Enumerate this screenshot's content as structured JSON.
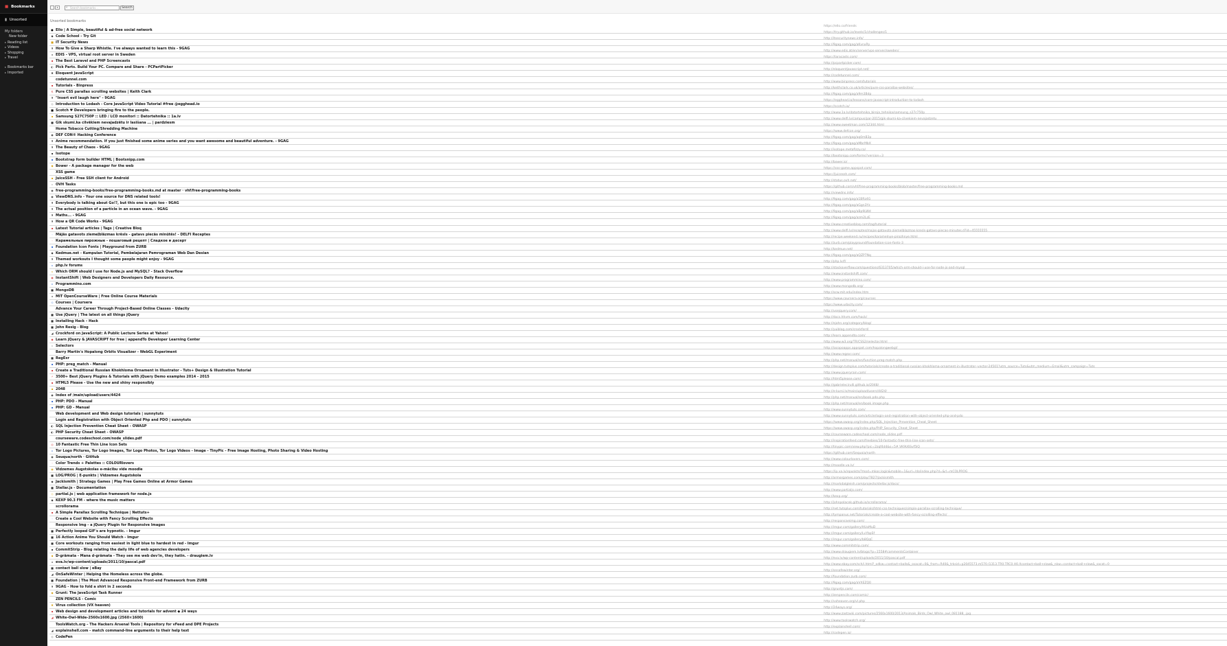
{
  "colors": {
    "sidebar_bg": "#1b1b1b",
    "accent": "#e04040",
    "url_text": "#9a9a9a"
  },
  "sidebar": {
    "title": "Bookmarks",
    "title_icon": "bookmark-icon",
    "unsorted": "Unsorted",
    "my_folders": "My folders",
    "folders": [
      {
        "label": "New folder",
        "indent": true
      },
      {
        "label": "Reading list"
      },
      {
        "label": "Videos"
      },
      {
        "label": "Shopping"
      },
      {
        "label": "Travel"
      }
    ],
    "other": [
      {
        "label": "Bookmarks bar"
      },
      {
        "label": "Imported"
      }
    ]
  },
  "toolbar": {
    "search_placeholder": "Search bookmarks...",
    "search_button": "Search"
  },
  "breadcrumb": "Unsorted bookmarks",
  "bookmarks": [
    {
      "title": "Ello | A Simple, beautiful & ad-free social network",
      "url": "https://ello.co/friends",
      "icon": "●",
      "color": "#000"
    },
    {
      "title": "Code School - Try Git",
      "url": "https://try.github.io/levels/1/challenges/1",
      "icon": "◆",
      "color": "#333"
    },
    {
      "title": "IT Security News",
      "url": "http://itsecuritynews.info/",
      "icon": "■",
      "color": "#d4a017"
    },
    {
      "title": "How To Give a Sharp Whistle. I've always wanted to learn this - 9GAG",
      "url": "http://9gag.com/gag/aKvnxPp",
      "icon": "9",
      "color": "#000"
    },
    {
      "title": "EDIS - VPS, virtual root server in Sweden",
      "url": "http://www.edis.at/en/server/vps-server/sweden/",
      "icon": "▪",
      "color": "#999"
    },
    {
      "title": "The Best Laravel and PHP Screencasts",
      "url": "https://laracasts.com/",
      "icon": "▪",
      "color": "#d04040"
    },
    {
      "title": "Pick Parts. Build Your PC. Compare and Share - PCPartPicker",
      "url": "http://pcpartpicker.com/",
      "icon": "◐",
      "color": "#555"
    },
    {
      "title": "Eloquent JavaScript",
      "url": "http://eloquentjavascript.net/",
      "icon": "✖",
      "color": "#333"
    },
    {
      "title": "codetunnel.com",
      "url": "http://codetunnel.com/",
      "icon": "",
      "color": "#999"
    },
    {
      "title": "Tutorials - Binpress",
      "url": "http://www.binpress.com/tutorials",
      "icon": "▪",
      "color": "#d04040"
    },
    {
      "title": "Pure CSS parallax scrolling websites | Keith Clark",
      "url": "http://keithclark.co.uk/articles/pure-css-parallax-websites/",
      "icon": "K",
      "color": "#d04040"
    },
    {
      "title": "\"Insert evil laugh here\" - 9GAG",
      "url": "http://9gag.com/gag/a9m3Bdp",
      "icon": "9",
      "color": "#000"
    },
    {
      "title": "Introduction to Lodash - Core JavaScript Video Tutorial #free @egghead.io",
      "url": "https://egghead.io/lessons/core-javascript-introduction-to-lodash",
      "icon": "◇",
      "color": "#555"
    },
    {
      "title": "Scotch ♥ Developers bringing fire to the people.",
      "url": "https://scotch.io/",
      "icon": "■",
      "color": "#000"
    },
    {
      "title": "Samsung S27C750P :: LED / LCD monitori :: Datortehnika :: 1a.lv",
      "url": "http://www.1a.lv/datortehnika_biroja_tehnika/samsung_s27c750p",
      "icon": "▪",
      "color": "#d4a017"
    },
    {
      "title": "Gik skumi.ka cilvēkiem nevajadzētu ir lasīšana ... | pardziesm",
      "url": "http://www.delfi.lv/campus/par-2015/gik-skumi-ka-cilvekiem-nevajadzetu",
      "icon": "■",
      "color": "#333"
    },
    {
      "title": "Home Tobacco Cutting/Shredding Machine",
      "url": "http://www.sweetman.com/12344.html",
      "icon": "",
      "color": "#999"
    },
    {
      "title": "DEF CON® Hacking Conference",
      "url": "https://www.defcon.org/",
      "icon": "◉",
      "color": "#333"
    },
    {
      "title": "Anime recommendation. If you just finished some anime series and you want awesome and beautiful adventure. - 9GAG",
      "url": "http://9gag.com/gag/aq0mB3p",
      "icon": "9",
      "color": "#000"
    },
    {
      "title": "The Beauty of Chaos - 9GAG",
      "url": "http://9gag.com/gag/aMbrMbX",
      "icon": "9",
      "color": "#000"
    },
    {
      "title": "Isotope",
      "url": "http://isotope.metafizzy.co/",
      "icon": "▪",
      "color": "#333"
    },
    {
      "title": "Bootstrap form builder HTML | Bootsnipp.com",
      "url": "http://bootsnipp.com/forms?version=3",
      "icon": "▪",
      "color": "#3a6fd0"
    },
    {
      "title": "Bower - A package manager for the web",
      "url": "http://bower.io/",
      "icon": "◆",
      "color": "#d4a017"
    },
    {
      "title": "XSS game",
      "url": "https://xss-game.appspot.com/",
      "icon": "",
      "color": "#999"
    },
    {
      "title": "JuiceSSH - Free SSH client for Android",
      "url": "https://juicessh.com/",
      "icon": "▪",
      "color": "#d4a017"
    },
    {
      "title": "OVH Tasks",
      "url": "http://status.ovh.net/",
      "icon": "▫",
      "color": "#999"
    },
    {
      "title": "free-programming-books/free-programming-books.md at master · vhf/free-programming-books",
      "url": "https://github.com/vhf/free-programming-books/blob/master/free-programming-books.md",
      "icon": "◉",
      "color": "#333"
    },
    {
      "title": "ViewDNS.info - Your one source for DNS related tools!",
      "url": "http://viewdns.info/",
      "icon": "◉",
      "color": "#333"
    },
    {
      "title": "Everybody is talking about Go!?, but this one is epic too - 9GAG",
      "url": "http://9gag.com/gag/a1BRz4G",
      "icon": "9",
      "color": "#000"
    },
    {
      "title": "The actual position of a particle in an ocean wave. - 9GAG",
      "url": "http://9gag.com/gag/aGgn3Yz",
      "icon": "9",
      "color": "#000"
    },
    {
      "title": "Maths... - 9GAG",
      "url": "http://9gag.com/gag/aBp9LWd",
      "icon": "9",
      "color": "#000"
    },
    {
      "title": "How a QR Code Works - 9GAG",
      "url": "http://9gag.com/gag/azm2LzE",
      "icon": "9",
      "color": "#000"
    },
    {
      "title": "Latest Tutorial articles | Tags | Creative Bloq",
      "url": "http://www.creativebloq.com/tag/tutorial",
      "icon": "▪",
      "color": "#d04040"
    },
    {
      "title": "Mājās gatavots ziemeļblāzmas krēsls - gatavs piecās minūtēs! - DELFI Receptes",
      "url": "http://www.delfi.lv/receptes/majas-gatavots-ziemelblazmas-kresls-gatavs-piecas-minutes.d?id=45555555",
      "icon": "◦",
      "color": "#3a6fd0"
    },
    {
      "title": "Карамельные пирожные - пошаговый рецепт | Сладкое и десерт",
      "url": "http://recipe.weekend.ru/recipes/karamelnye-pirozhnye.html",
      "icon": "◦",
      "color": "#d04040"
    },
    {
      "title": "Foundation Icon Fonts | Playground from ZURB",
      "url": "http://zurb.com/playground/foundation-icon-fonts-3",
      "icon": "▪",
      "color": "#3a6fd0"
    },
    {
      "title": "Kedmue.net - Kumpulan Tutorial, Pembelajaran Pemrograman Web Dan Desian",
      "url": "http://kedmue.net/",
      "icon": "◆",
      "color": "#333"
    },
    {
      "title": "Themed workouts I thought some people might enjoy - 9GAG",
      "url": "http://9gag.com/gag/aQZP7Nq",
      "icon": "9",
      "color": "#000"
    },
    {
      "title": "php.lv forums",
      "url": "http://php.lv/f/",
      "icon": "▫",
      "color": "#3a6fd0"
    },
    {
      "title": "Which ORM should I use for Node.js and MySQL? - Stack Overflow",
      "url": "http://stackoverflow.com/questions/6313705/which-orm-should-i-use-for-node-js-and-mysql",
      "icon": "▫",
      "color": "#d4a017"
    },
    {
      "title": "InstantShift | Web Designers and Developers Daily Resource.",
      "url": "http://www.instantshift.com/",
      "icon": "◉",
      "color": "#d04040"
    },
    {
      "title": "Programmino.com",
      "url": "http://www.programmino.com/",
      "icon": "▫",
      "color": "#3a6fd0"
    },
    {
      "title": "MongoDB",
      "url": "http://www.mongodb.org/",
      "icon": "■",
      "color": "#333"
    },
    {
      "title": "MIT OpenCourseWare | Free Online Course Materials",
      "url": "http://ocw.mit.edu/index.htm",
      "icon": "▪",
      "color": "#999"
    },
    {
      "title": "Courses | Coursera",
      "url": "https://www.coursera.org/courses",
      "icon": "◇",
      "color": "#3a6fd0"
    },
    {
      "title": "Advance Your Career Through Project-Based Online Classes - Udacity",
      "url": "https://www.udacity.com/",
      "icon": "",
      "color": "#999"
    },
    {
      "title": "Use jQuery | The latest on all things jQuery",
      "url": "http://usejquery.com/",
      "icon": "■",
      "color": "#333"
    },
    {
      "title": "Installing Hack – Hack",
      "url": "http://docs.hhvm.com/hack/",
      "icon": "■",
      "color": "#333"
    },
    {
      "title": "John Resig - Blog",
      "url": "http://ejohn.org/category/blog/",
      "icon": "■",
      "color": "#333"
    },
    {
      "title": "Crockford on JavaScript: A Public Lecture Series at Yahoo!",
      "url": "http://yuiblog.com/crockford/",
      "icon": "◢",
      "color": "#333"
    },
    {
      "title": "Learn jQuery & JAVASCRIPT for free | appendTo Developer Learning Center",
      "url": "http://learn.appendto.com/",
      "icon": "◆",
      "color": "#d04040"
    },
    {
      "title": "Selectors",
      "url": "http://www.w3.org/TR/CSS2/selector.html",
      "icon": "▫",
      "color": "#999"
    },
    {
      "title": "Barry Martin's Hopalong Orbits Visualizer - WebGL Experiment",
      "url": "http://iacopoapps.appspot.com/hopalongwebgl/",
      "icon": "",
      "color": "#999"
    },
    {
      "title": "RegExr",
      "url": "http://www.regexr.com/",
      "icon": "■",
      "color": "#333"
    },
    {
      "title": "PHP: preg_match - Manual",
      "url": "http://php.net/manual/en/function.preg-match.php",
      "icon": "▪",
      "color": "#3a6fd0"
    },
    {
      "title": "Create a Traditional Russian Khokhloma Ornament in Illustrator - Tuts+ Design & Illustration Tutorial",
      "url": "http://design.tutsplus.com/tutorials/create-a-traditional-russian-khokhloma-ornament-in-illustrator--vector-24501?utm_source=Tuts&utm_medium=Email&utm_campaign=Tuts",
      "icon": "▪",
      "color": "#d04040"
    },
    {
      "title": "3500+ Best jQuery Plugins & Tutorials with jQuery Demo examples 2014 - 2015",
      "url": "http://www.jqueryrain.com/",
      "icon": "⚡",
      "color": "#d04040"
    },
    {
      "title": "HTML5 Please - Use the new and shiny responsibly",
      "url": "http://html5please.com/",
      "icon": "▪",
      "color": "#d04040"
    },
    {
      "title": "2048",
      "url": "http://gabrielecirulli.github.io/2048/",
      "icon": "▪",
      "color": "#d4a017"
    },
    {
      "title": "Index of /main/upload/users/4424",
      "url": "http://e-kursi.lv/main/upload/users/4424/",
      "icon": "◉",
      "color": "#333"
    },
    {
      "title": "PHP: PDO - Manual",
      "url": "http://php.net/manual/en/book.pdo.php",
      "icon": "▪",
      "color": "#3a6fd0"
    },
    {
      "title": "PHP: GD - Manual",
      "url": "http://php.net/manual/en/book.image.php",
      "icon": "▪",
      "color": "#3a6fd0"
    },
    {
      "title": "Web development and Web design tutorials | sunnytuts",
      "url": "http://www.sunnytuts.com/",
      "icon": "",
      "color": "#999"
    },
    {
      "title": "Login and Registration with Object Oriented Php and PDO | sunnytuts",
      "url": "http://www.sunnytuts.com/article/login-and-registration-with-object-oriented-php-and-pdo",
      "icon": "",
      "color": "#999"
    },
    {
      "title": "SQL Injection Prevention Cheat Sheet - OWASP",
      "url": "https://www.owasp.org/index.php/SQL_Injection_Prevention_Cheat_Sheet",
      "icon": "◐",
      "color": "#333"
    },
    {
      "title": "PHP Security Cheat Sheet - OWASP",
      "url": "https://www.owasp.org/index.php/PHP_Security_Cheat_Sheet",
      "icon": "◐",
      "color": "#333"
    },
    {
      "title": "courseware.codeschool.com/node_slides.pdf",
      "url": "http://courseware.codeschool.com/node_slides.pdf",
      "icon": "",
      "color": "#999"
    },
    {
      "title": "10 Fantastic Free Thin Line Icon Sets",
      "url": "http://inspirationfeed.com/freebies/10-fantastic-free-thin-line-icon-sets/",
      "icon": "◎",
      "color": "#d04040"
    },
    {
      "title": "Tor Logo Pictures, Tor Logo Images, Tor Logo Photos, Tor Logo Videos - Image - TinyPic - Free Image Hosting, Photo Sharing & Video Hosting",
      "url": "http://tinypic.com/view.php?pic=2zqf4d4&s=5#.VK9U6Svf5IQ",
      "icon": "▫",
      "color": "#3a6fd0"
    },
    {
      "title": "Seuqua/north · GitHub",
      "url": "https://github.com/Sequoia/north",
      "icon": "◉",
      "color": "#333"
    },
    {
      "title": "Color Trends + Palettes :: COLOURlovers",
      "url": "http://www.colourlovers.com/",
      "icon": "◦",
      "color": "#d04040"
    },
    {
      "title": "Vidzemes Augstskolas e-mācību vide moodle",
      "url": "http://moodle.va.lv/",
      "icon": "◉",
      "color": "#d4a017"
    },
    {
      "title": "LOG/PROG | E-punkts | Vidzemes Augstskola",
      "url": "https://ip.va.lv/epunkts/?mod=mkos.login&mobile=1&url=/do/index.php?d=&rl=mCOLPROG",
      "icon": "■",
      "color": "#333"
    },
    {
      "title": "Jackismith | Strategy Games | Play Free Games Online at Armor Games",
      "url": "http://armorgames.com/play/7827/jackismith",
      "icon": "◆",
      "color": "#333"
    },
    {
      "title": "Stellar.js - Documentation",
      "url": "http://markdalgleish.com/projects/stellar.js/docs/",
      "icon": "■",
      "color": "#333"
    },
    {
      "title": "partial.js | web application framework for node.js",
      "url": "http://www.partialjs.com/",
      "icon": "◇",
      "color": "#d4a017"
    },
    {
      "title": "KEXP 90.3 FM - where the music matters",
      "url": "http://kexp.org/",
      "icon": "◆",
      "color": "#333"
    },
    {
      "title": "scrollorama",
      "url": "http://johnpolacek.github.io/scrollorama/",
      "icon": "",
      "color": "#999"
    },
    {
      "title": "A Simple Parallax Scrolling Technique | Nettuts+",
      "url": "http://net.tutsplus.com/tutorials/html-css-techniques/simple-parallax-scrolling-technique/",
      "icon": "▪",
      "color": "#d04040"
    },
    {
      "title": "Create a Cool Website with Fancy Scrolling Effects",
      "url": "http://tympanus.net/Tutorials/create-a-cool-website-with-fancy-scrolling-effects/",
      "icon": "◦",
      "color": "#3a6fd0"
    },
    {
      "title": "Responsive Img - a jQuery Plugin for Responsive Images",
      "url": "http://responsiveimg.com/",
      "icon": "",
      "color": "#999"
    },
    {
      "title": "Perfectly looped GIF's are hypnotic. - Imgur",
      "url": "http://imgur.com/gallery/ItUoMuD",
      "icon": "■",
      "color": "#333"
    },
    {
      "title": "16 Action Anime You Should Watch - Imgur",
      "url": "http://imgur.com/gallery/LvYbpSf",
      "icon": "■",
      "color": "#333"
    },
    {
      "title": "Core workouts ranging from easiest in light blue to hardest in red - Imgur",
      "url": "http://imgur.com/gallery/b8QqC",
      "icon": "■",
      "color": "#333"
    },
    {
      "title": "CommitStrip - Blog relating the daily life of web agencies developers",
      "url": "http://www.commitstrip.com/",
      "icon": "▪",
      "color": "#333"
    },
    {
      "title": "D-grāmata - Mana d-grāmata - They see me web dev'in, they hatin. - draugiem.lv",
      "url": "http://www.draugiem.lv/blogs/?p=1558#commentsContainer",
      "icon": "▪",
      "color": "#d4a017"
    },
    {
      "title": "eva.lv/wp-content/uploads/2011/10/pascal.pdf",
      "url": "http://eva.lv/wp-content/uploads/2011/10/pascal.pdf",
      "icon": "▪",
      "color": "#999"
    },
    {
      "title": "contact ball slow | eBay",
      "url": "http://www.ebay.com/sch/i.html?_odkw=contact+balls&_osacat=0&_from=R40&_trksid=p2045573.m570.l1313.TR0.TRC0.H0.Xcontact+ball+slow&_nkw=contact+ball+slow&_sacat=0",
      "icon": "■",
      "color": "#333"
    },
    {
      "title": "OnSafeWinter | Helping the Homeless across the globe.",
      "url": "http://onsafewinter.org/",
      "icon": "◢",
      "color": "#333"
    },
    {
      "title": "Foundation | The Most Advanced Responsive Front-end Framework from ZURB",
      "url": "http://foundation.zurb.com/",
      "icon": "■",
      "color": "#333"
    },
    {
      "title": "9GAG - How to fold a shirt in 2 seconds",
      "url": "http://9gag.com/gag/aVXEZQ0",
      "icon": "9",
      "color": "#000"
    },
    {
      "title": "Grunt: The JavaScript Task Runner",
      "url": "http://gruntjs.com/",
      "icon": "◆",
      "color": "#d4a017"
    },
    {
      "title": "ZEN PENCILS - Comic",
      "url": "http://zenpencils.com/comic/",
      "icon": "",
      "color": "#999"
    },
    {
      "title": "Virus collection (VX heaven)",
      "url": "http://vxheaven.org/vl.php",
      "icon": "✖",
      "color": "#d4a017"
    },
    {
      "title": "Web design and development articles and tutorials for advent ◆ 24 ways",
      "url": "http://24ways.org/",
      "icon": "▪",
      "color": "#d04040"
    },
    {
      "title": "White-Owl-Wide-2560x1600.jpg (2560×1600)",
      "url": "http://www.zastavki.com/pictures/2560x1600/2013/Animals_Birds_Owl_White_owl_081188_.jpg",
      "icon": "◢",
      "color": "#d04040"
    },
    {
      "title": "ToolsWatch.org – The Hackers Arsenal Tools | Repository for vFeed and DPE Projects",
      "url": "http://www.toolswatch.org/",
      "icon": "",
      "color": "#999"
    },
    {
      "title": "explainshell.com - match command-line arguments to their help text",
      "url": "http://explainshell.com/",
      "icon": "◢",
      "color": "#333"
    },
    {
      "title": "CodePen",
      "url": "http://codepen.io/",
      "icon": "◇",
      "color": "#333"
    }
  ]
}
